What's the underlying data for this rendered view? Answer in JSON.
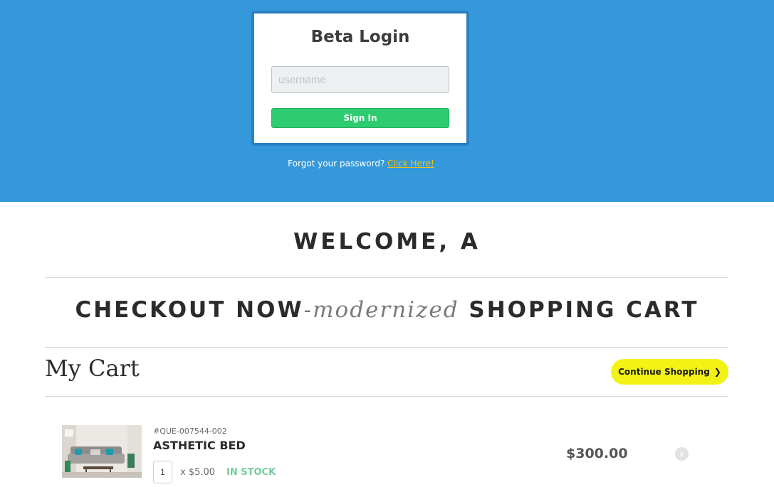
{
  "login": {
    "title": "Beta Login",
    "username_placeholder": "username",
    "signin_label": "Sign In",
    "forgot_text": "Forgot your password?",
    "forgot_link": "Click Here!"
  },
  "welcome": "WELCOME, A",
  "headline": {
    "part1": "CHECKOUT NOW",
    "accent": "-modernized",
    "part2": "SHOPPING CART"
  },
  "cart": {
    "title": "My Cart",
    "continue_label": "Continue Shopping",
    "continue_icon": "chevron-right-icon",
    "items": [
      {
        "sku": "#QUE-007544-002",
        "name": "ASTHETIC BED",
        "quantity": "1",
        "unit_price": "x $5.00",
        "stock": "IN STOCK",
        "total": "$300.00",
        "remove_label": "x",
        "image_icon": "sofa-product-image"
      }
    ]
  },
  "colors": {
    "banner": "#3498db",
    "signin": "#2ecc71",
    "link": "#f1c40f",
    "continue": "#f2f216",
    "in_stock": "#6fcf97"
  }
}
